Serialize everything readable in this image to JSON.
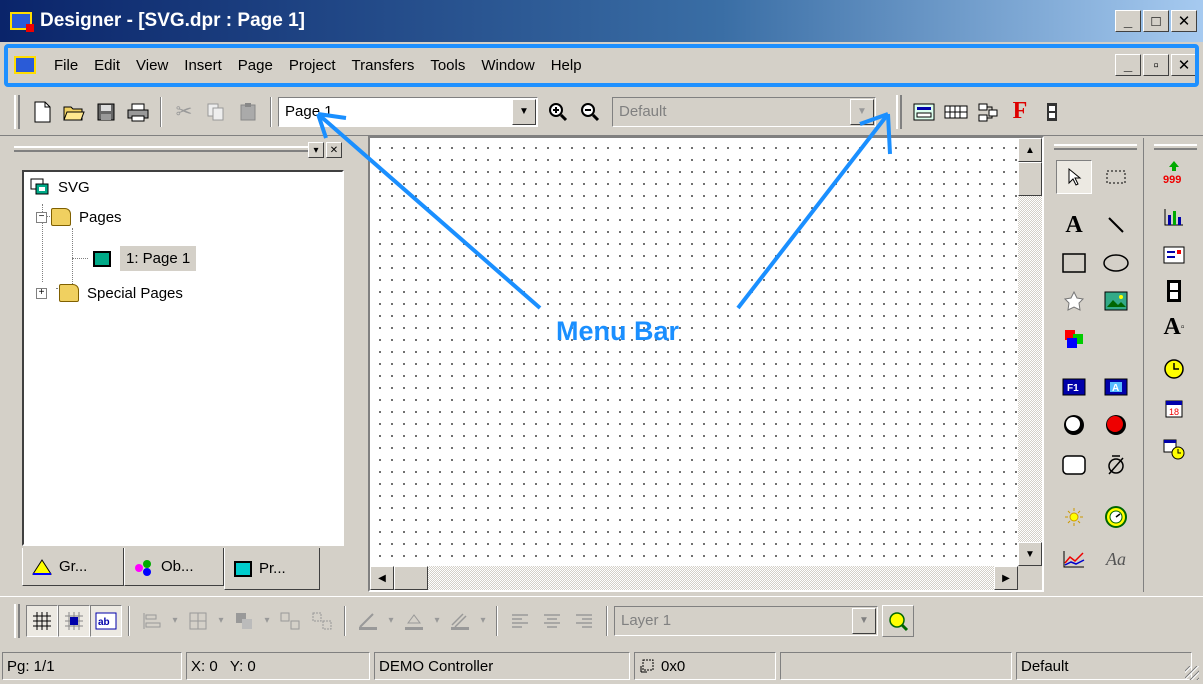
{
  "window": {
    "title": "Designer - [SVG.dpr : Page 1]",
    "controls": [
      "_",
      "□",
      "✕"
    ],
    "doc_controls": [
      "_",
      "▫",
      "✕"
    ]
  },
  "menu": {
    "items": [
      "File",
      "Edit",
      "View",
      "Insert",
      "Page",
      "Project",
      "Transfers",
      "Tools",
      "Window",
      "Help"
    ]
  },
  "toolbar": {
    "page_combo_value": "Page 1",
    "style_combo_value": "Default",
    "buttons": [
      "new-icon",
      "open-icon",
      "save-icon",
      "print-icon",
      "cut-icon",
      "copy-icon",
      "paste-icon",
      "zoom-in-icon",
      "zoom-out-icon"
    ]
  },
  "left_panel": {
    "tree": {
      "root": "SVG",
      "pages_folder": "Pages",
      "page_item": "1: Page 1",
      "special_folder": "Special Pages"
    },
    "tabs": [
      "Gr...",
      "Ob...",
      "Pr..."
    ]
  },
  "bottom_toolbar": {
    "layer_combo_value": "Layer 1"
  },
  "status_bar": {
    "page": "Pg: 1/1",
    "coords": "X: 0   Y: 0",
    "controller": "DEMO Controller",
    "size": "0x0",
    "empty": "",
    "style": "Default"
  },
  "annotation": {
    "label": "Menu Bar",
    "color": "#1a8fff"
  },
  "colors": {
    "title_bar_start": "#0a246a",
    "title_bar_end": "#a6caf0",
    "face": "#d4d0c8",
    "highlight": "#1e90ff"
  }
}
